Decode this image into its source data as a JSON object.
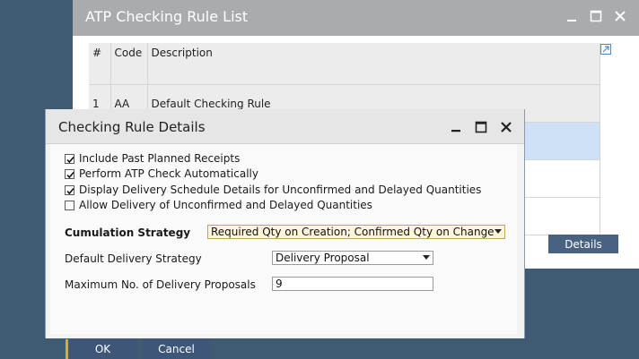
{
  "list_window": {
    "title": "ATP Checking Rule List",
    "columns": [
      "#",
      "Code",
      "Description"
    ],
    "rows": [
      {
        "num": "1",
        "code": "AA",
        "description": "Default Checking Rule"
      }
    ],
    "details_label": "Details"
  },
  "dialog": {
    "title": "Checking Rule Details",
    "checkboxes": [
      {
        "label": "Include Past Planned Receipts",
        "checked": true
      },
      {
        "label": "Perform ATP Check Automatically",
        "checked": true
      },
      {
        "label": "Display Delivery Schedule Details for Unconfirmed and Delayed Quantities",
        "checked": true
      },
      {
        "label": "Allow Delivery of Unconfirmed and Delayed Quantities",
        "checked": false
      }
    ],
    "cumulation_strategy": {
      "label": "Cumulation Strategy",
      "value": "Required Qty on Creation; Confirmed Qty on Change"
    },
    "default_delivery_strategy": {
      "label": "Default Delivery Strategy",
      "value": "Delivery Proposal"
    },
    "max_delivery_proposals": {
      "label": "Maximum No. of Delivery Proposals",
      "value": "9"
    },
    "ok_label": "OK",
    "cancel_label": "Cancel"
  },
  "colors": {
    "desktop": "#3f5a73",
    "list_titlebar": "#aaabad",
    "button": "#3e5778",
    "button_accent": "#e5a531",
    "selected_row": "#cfe1f6",
    "highlight_field": "#fff6d9"
  },
  "icons": [
    "minimize-icon",
    "maximize-icon",
    "close-icon",
    "expand-icon",
    "dropdown-arrow-icon",
    "checkmark-icon"
  ]
}
